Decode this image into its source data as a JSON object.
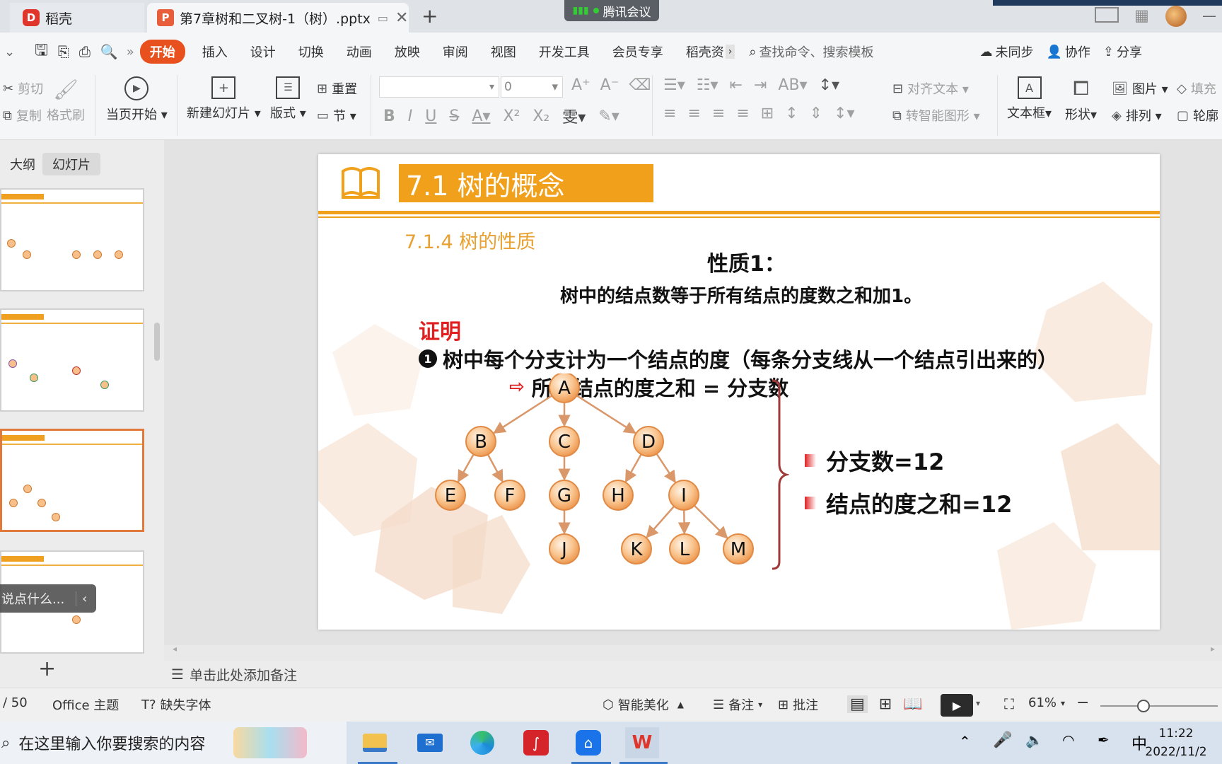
{
  "titlebar": {
    "tab1": "稻壳",
    "tab2": "第7章树和二叉树-1（树）.pptx",
    "meeting": "腾讯会议"
  },
  "menu": {
    "items": [
      "开始",
      "插入",
      "设计",
      "切换",
      "动画",
      "放映",
      "审阅",
      "视图",
      "开发工具",
      "会员专享",
      "稻壳资"
    ],
    "search_placeholder": "查找命令、搜索模板",
    "sync": "未同步",
    "collab": "协作",
    "share": "分享"
  },
  "ribbon": {
    "cut": "剪切",
    "copy": "复制",
    "format_painter": "格式刷",
    "from_current": "当页开始",
    "new_slide": "新建幻灯片",
    "layout": "版式",
    "reset": "重置",
    "section": "节",
    "font_size": "0",
    "align_text": "对齐文本",
    "smart_shape": "转智能图形",
    "textbox": "文本框",
    "shape": "形状",
    "picture": "图片",
    "arrange": "排列",
    "fill": "填充",
    "outline": "轮廓"
  },
  "leftpanel": {
    "tab_outline": "大纲",
    "tab_slides": "幻灯片",
    "overlay_text": "说点什么..."
  },
  "slide": {
    "title": "7.1  树的概念",
    "subtitle": "7.1.4   树的性质",
    "property_title": "性质1：",
    "property_text": "树中的结点数等于所有结点的度数之和加1。",
    "proof": "证明",
    "bullet1": "树中每个分支计为一个结点的度（每条分支线从一个结点引出来的）",
    "bullet2": "所有结点的度之和 = 分支数",
    "right1": "分支数=12",
    "right2": "结点的度之和=12",
    "nodes": [
      "A",
      "B",
      "C",
      "D",
      "E",
      "F",
      "G",
      "H",
      "I",
      "J",
      "K",
      "L",
      "M"
    ]
  },
  "notes": {
    "placeholder": "单击此处添加备注"
  },
  "status": {
    "page": "/ 50",
    "theme": "Office 主题",
    "missing_font": "缺失字体",
    "beautify": "智能美化",
    "notes": "备注",
    "comment": "批注",
    "zoom": "61%"
  },
  "taskbar": {
    "search": "在这里输入你要搜索的内容",
    "ime": "中",
    "time": "11:22",
    "date": "2022/11/2"
  },
  "colors": {
    "accent_orange": "#f0a01a",
    "wps_red": "#e8501e",
    "proof_red": "#e02020"
  }
}
